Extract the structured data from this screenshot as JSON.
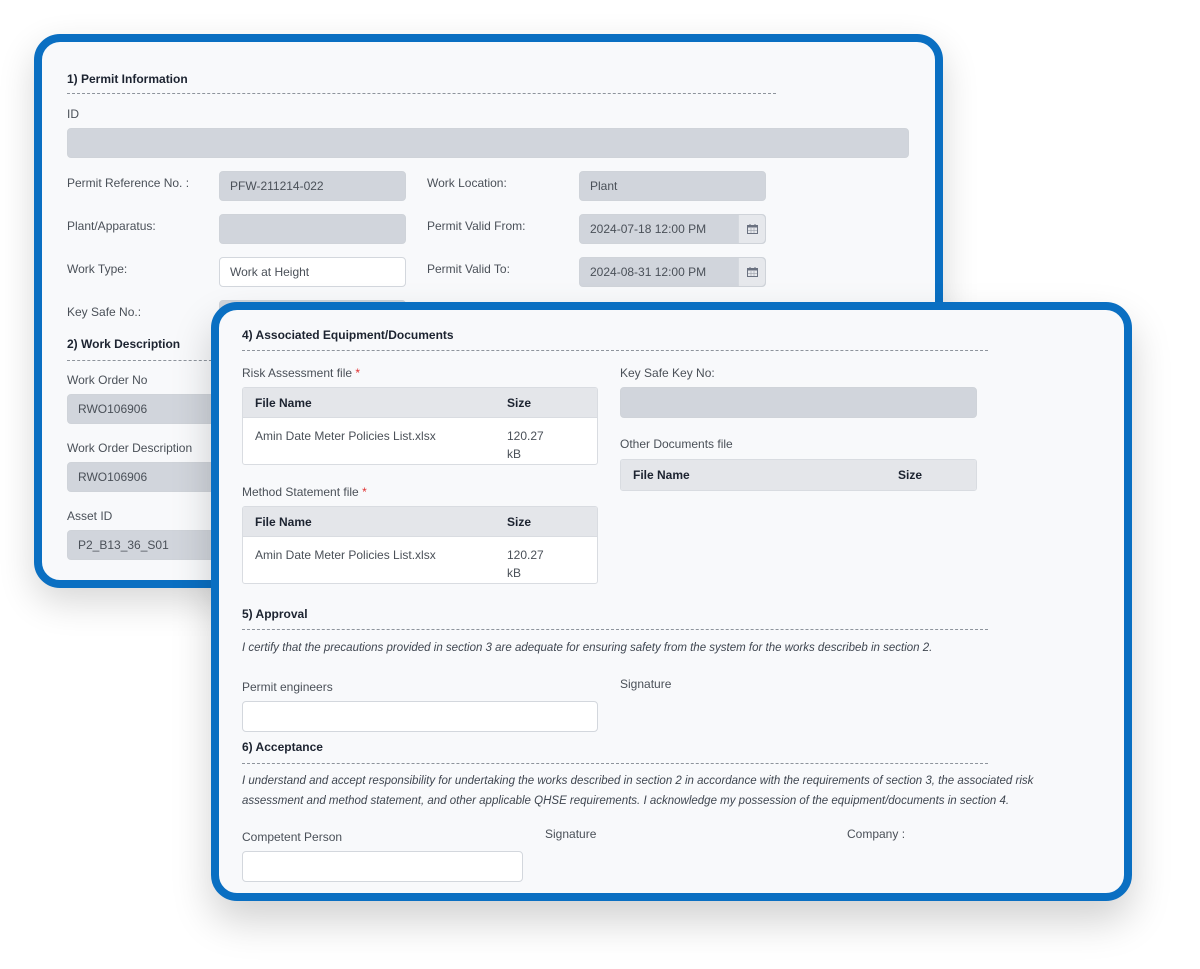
{
  "permit_form": {
    "section1": {
      "title": "1) Permit Information",
      "id_label": "ID",
      "id_value": "",
      "permit_ref_label": "Permit Reference No. :",
      "permit_ref_value": "PFW-211214-022",
      "work_location_label": "Work Location:",
      "work_location_value": "Plant",
      "plant_label": "Plant/Apparatus:",
      "plant_value": "",
      "valid_from_label": "Permit Valid From:",
      "valid_from_value": "2024-07-18 12:00 PM",
      "work_type_label": "Work Type:",
      "work_type_value": "Work at Height",
      "valid_to_label": "Permit Valid To:",
      "valid_to_value": "2024-08-31 12:00 PM",
      "key_safe_label": "Key Safe No.:",
      "calendar_icon": "calendar-icon"
    },
    "section2": {
      "title": "2) Work Description",
      "work_order_no_label": "Work Order No",
      "work_order_no_value": "RWO106906",
      "work_order_desc_label": "Work Order Description",
      "work_order_desc_value": "RWO106906",
      "asset_id_label": "Asset ID",
      "asset_id_value": "P2_B13_36_S01"
    },
    "section4": {
      "title": "4) Associated Equipment/Documents",
      "risk_label": "Risk Assessment file",
      "method_label": "Method Statement file",
      "required_mark": "*",
      "key_safe_key_label": "Key Safe Key No:",
      "key_safe_key_value": "",
      "other_docs_label": "Other Documents file",
      "columns": {
        "name": "File Name",
        "size": "Size"
      },
      "risk_files": [
        {
          "name": "Amin Date Meter Policies List.xlsx",
          "size_num": "120.27",
          "size_unit": "kB"
        }
      ],
      "method_files": [
        {
          "name": "Amin Date Meter Policies List.xlsx",
          "size_num": "120.27",
          "size_unit": "kB"
        }
      ],
      "other_files": []
    },
    "section5": {
      "title": "5) Approval",
      "statement": "I certify that the precautions provided in section 3 are adequate for ensuring safety from the system for the works describeb in section 2.",
      "engineers_label": "Permit engineers",
      "engineers_value": "",
      "signature_label": "Signature"
    },
    "section6": {
      "title": "6) Acceptance",
      "statement_line1": "I understand and accept responsibility for undertaking the works described in section 2 in accordance with the requirements of section 3, the associated risk",
      "statement_line2": "assessment and method statement, and other applicable QHSE requirements. I acknowledge my possession of the equipment/documents in section 4.",
      "competent_label": "Competent Person",
      "competent_value": "",
      "signature_label": "Signature",
      "company_label": "Company :"
    }
  },
  "colors": {
    "card_border": "#0a6fc2",
    "readonly_field": "#d1d5dc",
    "required": "#e03131"
  }
}
